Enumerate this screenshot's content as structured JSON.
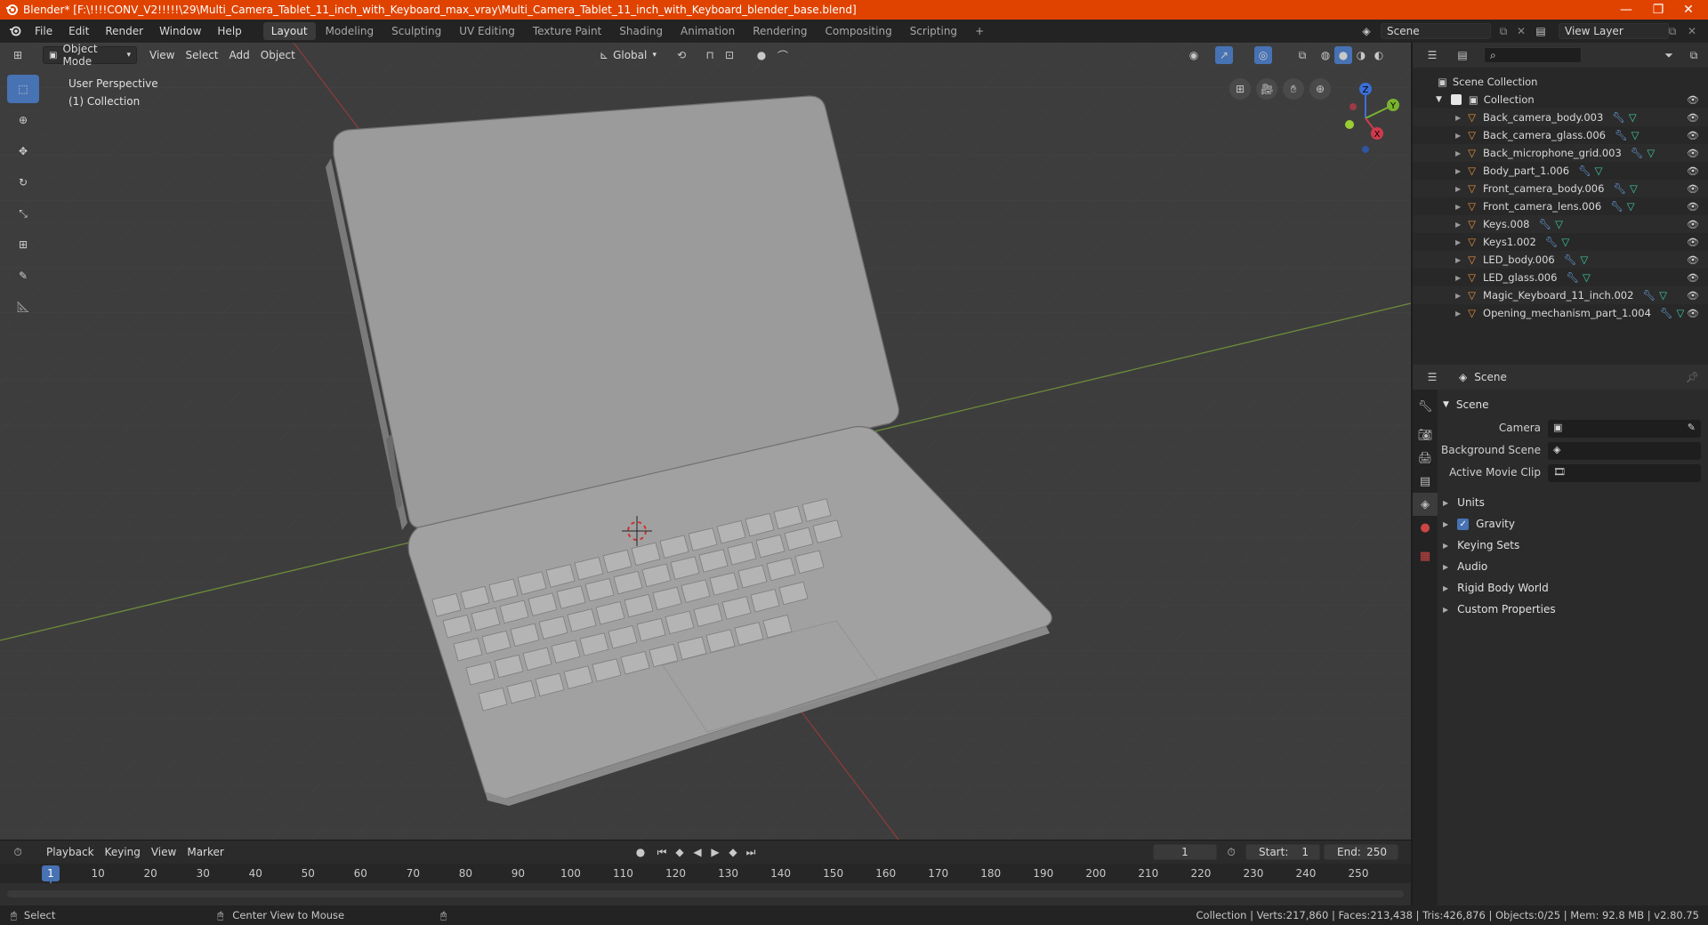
{
  "title_bar": {
    "title": "Blender* [F:\\!!!!CONV_V2!!!!!\\29\\Multi_Camera_Tablet_11_inch_with_Keyboard_max_vray\\Multi_Camera_Tablet_11_inch_with_Keyboard_blender_base.blend]",
    "minimize": "—",
    "maximize": "❐",
    "close": "✕"
  },
  "menu": {
    "items": [
      "File",
      "Edit",
      "Render",
      "Window",
      "Help"
    ],
    "workspaces": [
      "Layout",
      "Modeling",
      "Sculpting",
      "UV Editing",
      "Texture Paint",
      "Shading",
      "Animation",
      "Rendering",
      "Compositing",
      "Scripting"
    ],
    "add_workspace": "+",
    "scene_name": "Scene",
    "view_layer": "View Layer"
  },
  "viewport": {
    "mode": "Object Mode",
    "menus": [
      "View",
      "Select",
      "Add",
      "Object"
    ],
    "orientation": "Global",
    "perspective": "User Perspective",
    "collection": "(1) Collection",
    "gizmo": {
      "z": "Z",
      "y": "Y",
      "x": "X"
    }
  },
  "outliner": {
    "root": "Scene Collection",
    "collection": "Collection",
    "objects": [
      "Back_camera_body.003",
      "Back_camera_glass.006",
      "Back_microphone_grid.003",
      "Body_part_1.006",
      "Front_camera_body.006",
      "Front_camera_lens.006",
      "Keys.008",
      "Keys1.002",
      "LED_body.006",
      "LED_glass.006",
      "Magic_Keyboard_11_inch.002",
      "Opening_mechanism_part_1.004"
    ]
  },
  "properties": {
    "header": "Scene",
    "section": "Scene",
    "fields": [
      "Camera",
      "Background Scene",
      "Active Movie Clip"
    ],
    "subsections": [
      "Units",
      "Gravity",
      "Keying Sets",
      "Audio",
      "Rigid Body World",
      "Custom Properties"
    ],
    "gravity_checked": true
  },
  "timeline": {
    "menus": [
      "Playback",
      "Keying",
      "View",
      "Marker"
    ],
    "current_frame": "1",
    "start_label": "Start:",
    "start": "1",
    "end_label": "End:",
    "end": "250",
    "ticks": [
      "1",
      "10",
      "20",
      "30",
      "40",
      "50",
      "60",
      "70",
      "80",
      "90",
      "100",
      "110",
      "120",
      "130",
      "140",
      "150",
      "160",
      "170",
      "180",
      "190",
      "200",
      "210",
      "220",
      "230",
      "240",
      "250"
    ]
  },
  "status": {
    "select": "Select",
    "center": "Center View to Mouse",
    "stats": "Collection | Verts:217,860 | Faces:213,438 | Tris:426,876 | Objects:0/25 | Mem: 92.8 MB | v2.80.75"
  },
  "colors": {
    "titlebar": "#e04300",
    "accent": "#4772b3",
    "mesh_icon": "#e8923b",
    "modifier_icon": "#6aa1e0",
    "data_icon": "#3fc9a5"
  }
}
